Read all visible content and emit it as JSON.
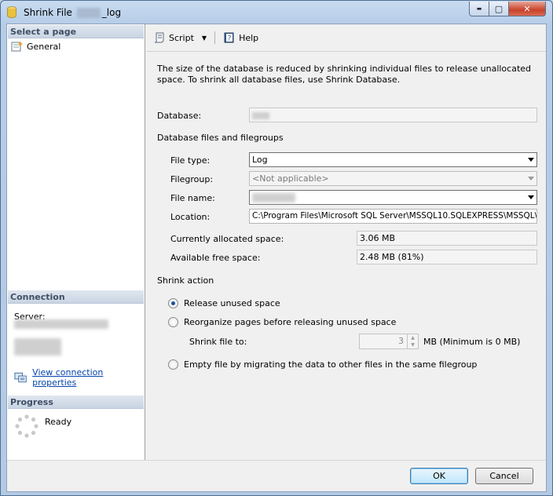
{
  "window": {
    "title_prefix": "Shrink File",
    "title_suffix": "_log",
    "min_label": "▬",
    "max_label": "▢",
    "close_label": "✕"
  },
  "left": {
    "select_page_header": "Select a page",
    "pages": [
      {
        "label": "General",
        "icon": "page-icon"
      }
    ],
    "connection_header": "Connection",
    "server_label": "Server:",
    "view_connection_link": "View connection properties",
    "progress_header": "Progress",
    "progress_status": "Ready"
  },
  "toolbar": {
    "script_label": "Script",
    "help_label": "Help"
  },
  "form": {
    "description": "The size of the database is reduced by shrinking individual files to release unallocated space. To shrink all database files, use Shrink Database.",
    "database_label": "Database:",
    "files_section_label": "Database files and filegroups",
    "file_type_label": "File type:",
    "file_type_value": "Log",
    "filegroup_label": "Filegroup:",
    "filegroup_value": "<Not applicable>",
    "file_name_label": "File name:",
    "location_label": "Location:",
    "location_value": "C:\\Program Files\\Microsoft SQL Server\\MSSQL10.SQLEXPRESS\\MSSQL\\",
    "allocated_label": "Currently allocated space:",
    "allocated_value": "3.06 MB",
    "free_label": "Available free space:",
    "free_value": "2.48 MB (81%)",
    "shrink_action_label": "Shrink action",
    "options": {
      "release": "Release unused space",
      "reorganize": "Reorganize pages before releasing unused space",
      "empty": "Empty file by migrating the data to other files in the same filegroup"
    },
    "selected_option": "release",
    "shrink_to_label": "Shrink file to:",
    "shrink_to_value": "3",
    "shrink_to_unit": "MB (Minimum is 0 MB)"
  },
  "buttons": {
    "ok": "OK",
    "cancel": "Cancel"
  }
}
